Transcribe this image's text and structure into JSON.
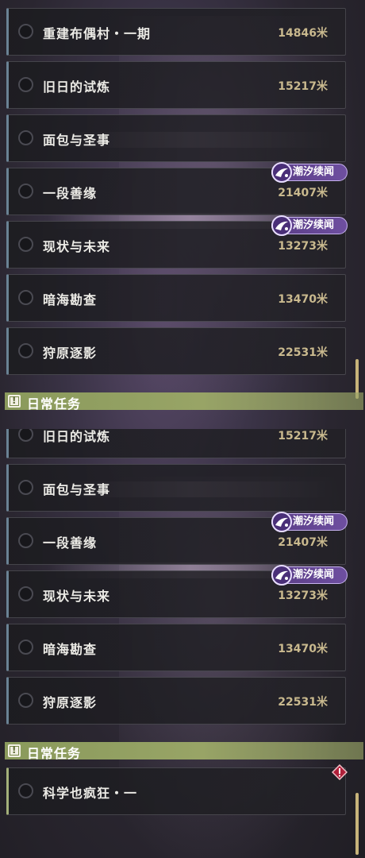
{
  "panel_1": {
    "quests": [
      {
        "name": "重建布偶村・一期",
        "distance": "14846米"
      },
      {
        "name": "旧日的试炼",
        "distance": "15217米"
      },
      {
        "name": "面包与圣事",
        "distance": ""
      },
      {
        "name": "一段善缘",
        "distance": "21407米",
        "tag": "潮汐续闻"
      },
      {
        "name": "现状与未来",
        "distance": "13273米",
        "tag": "潮汐续闻"
      },
      {
        "name": "暗海勘查",
        "distance": "13470米"
      },
      {
        "name": "狩原逐影",
        "distance": "22531米"
      }
    ],
    "section_header": "日常任务"
  },
  "panel_2": {
    "quests": [
      {
        "name": "旧日的试炼",
        "distance": "15217米"
      },
      {
        "name": "面包与圣事",
        "distance": ""
      },
      {
        "name": "一段善缘",
        "distance": "21407米",
        "tag": "潮汐续闻"
      },
      {
        "name": "现状与未来",
        "distance": "13273米",
        "tag": "潮汐续闻"
      },
      {
        "name": "暗海勘查",
        "distance": "13470米"
      },
      {
        "name": "狩原逐影",
        "distance": "22531米"
      }
    ],
    "section_header": "日常任务",
    "daily_quests": [
      {
        "name": "科学也疯狂・一"
      }
    ]
  },
  "colors": {
    "quest_name": "#ecebe6",
    "distance": "#c9b98e",
    "tag_bg": "#5a3d86",
    "section_header": "#98a466",
    "alert": "#d0304a"
  }
}
